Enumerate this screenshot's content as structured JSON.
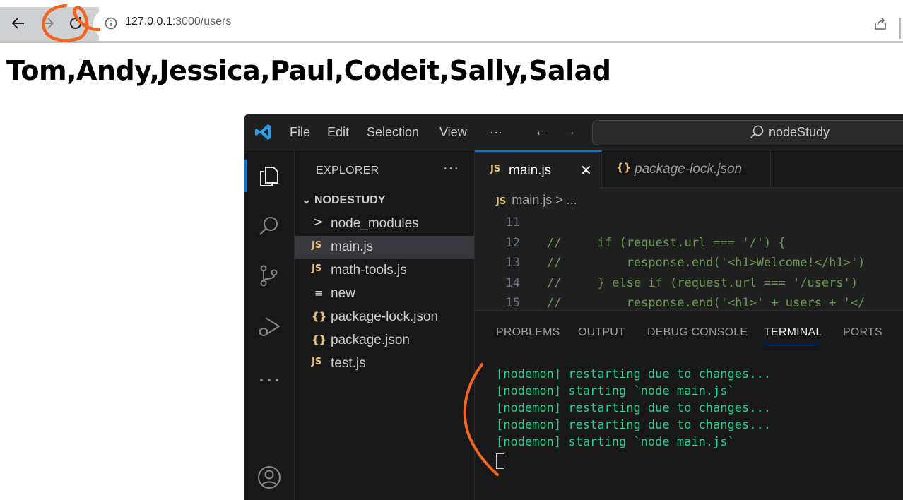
{
  "browser": {
    "url_host": "127.0.0.1",
    "url_path": ":3000/users",
    "icons": [
      "back-arrow-icon",
      "forward-arrow-icon",
      "reload-icon",
      "info-icon",
      "share-icon"
    ]
  },
  "page": {
    "heading": "Tom,Andy,Jessica,Paul,Codeit,Sally,Salad"
  },
  "vscode": {
    "menu": [
      "File",
      "Edit",
      "Selection",
      "View",
      "···"
    ],
    "search_text": "nodeStudy",
    "explorer": {
      "title": "EXPLORER",
      "more": "···",
      "folder": "NODESTUDY",
      "items": [
        {
          "label": "node_modules",
          "icon": ">"
        },
        {
          "label": "main.js",
          "icon": "JS"
        },
        {
          "label": "math-tools.js",
          "icon": "JS"
        },
        {
          "label": "new",
          "icon": "≡"
        },
        {
          "label": "package-lock.json",
          "icon": "{}"
        },
        {
          "label": "package.json",
          "icon": "{}"
        },
        {
          "label": "test.js",
          "icon": "JS"
        }
      ]
    },
    "tabs": [
      {
        "icon": "JS",
        "label": "main.js",
        "close": "✕"
      },
      {
        "icon": "{}",
        "label": "package-lock.json"
      }
    ],
    "breadcrumb": {
      "icon": "JS",
      "text": "main.js > ..."
    },
    "code_lines": [
      {
        "num": "11",
        "text": ""
      },
      {
        "num": "12",
        "text": "//     if (request.url === '/') {"
      },
      {
        "num": "13",
        "text": "//         response.end('<h1>Welcome!</h1>')"
      },
      {
        "num": "14",
        "text": "//     } else if (request.url === '/users') "
      },
      {
        "num": "15",
        "text": "//         response.end('<h1>' + users + '</"
      }
    ],
    "panel_tabs": [
      "PROBLEMS",
      "OUTPUT",
      "DEBUG CONSOLE",
      "TERMINAL",
      "PORTS"
    ],
    "terminal": [
      "[nodemon] restarting due to changes...",
      "[nodemon] starting `node main.js`",
      "[nodemon] restarting due to changes...",
      "[nodemon] restarting due to changes...",
      "[nodemon] starting `node main.js`"
    ],
    "colors": {
      "accent": "#0078d4",
      "terminal_text": "#23d18b",
      "annotation": "#f26522"
    }
  }
}
